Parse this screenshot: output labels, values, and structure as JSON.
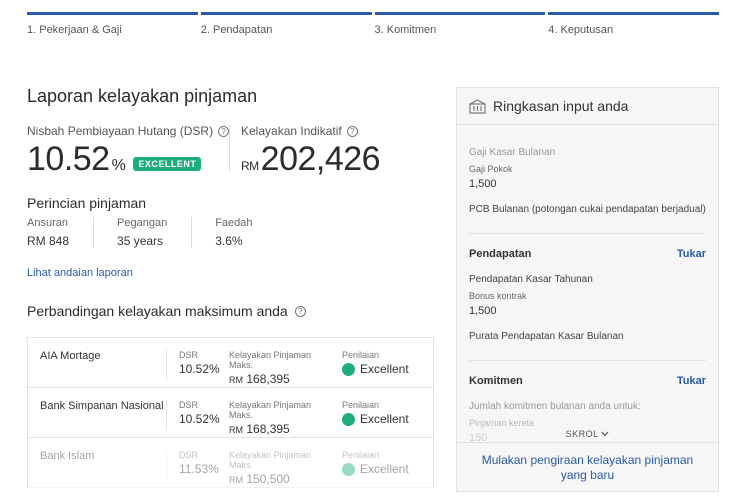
{
  "steps": [
    "1. Pekerjaan & Gaji",
    "2. Pendapatan",
    "3. Komitmen",
    "4. Keputusan"
  ],
  "report": {
    "title": "Laporan kelayakan pinjaman",
    "dsr_label": "Nisbah Pembiayaan Hutang (DSR)",
    "dsr_value": "10.52",
    "dsr_unit": "%",
    "dsr_badge": "EXCELLENT",
    "kel_label": "Kelayakan Indikatif",
    "kel_currency": "RM",
    "kel_value": "202,426"
  },
  "loan": {
    "title": "Perincian pinjaman",
    "cols": [
      {
        "label": "Ansuran",
        "value": "RM 848"
      },
      {
        "label": "Pegangan",
        "value": "35 years"
      },
      {
        "label": "Faedah",
        "value": "3.6%"
      }
    ],
    "link": "Lihat andaian laporan"
  },
  "comparison": {
    "title": "Perbandingan kelayakan maksimum anda",
    "col_dsr": "DSR",
    "col_kel": "Kelayakan Pinjaman Maks.",
    "col_rating": "Penilaian",
    "rows": [
      {
        "bank": "AIA Mortage",
        "dsr": "10.52%",
        "rm": "RM",
        "amount": "168,395",
        "rating": "Excellent"
      },
      {
        "bank": "Bank Simpanan Nasional",
        "dsr": "10.52%",
        "rm": "RM",
        "amount": "168,395",
        "rating": "Excellent"
      },
      {
        "bank": "Bank Islam",
        "dsr": "11.53%",
        "rm": "RM",
        "amount": "150,500",
        "rating": "Excellent"
      }
    ]
  },
  "panel": {
    "title": "Ringkasan input anda",
    "gaji_kasar": "Gaji Kasar Bulanan",
    "gaji_pokok": "Gaji Pokok",
    "gaji_pokok_val": "1,500",
    "pcb": "PCB Bulanan (potongan cukai pendapatan berjadual)",
    "pendapatan_head": "Pendapatan",
    "edit": "Tukar",
    "pendapatan_tahunan": "Pendapatan Kasar Tahunan",
    "bonus": "Bonus kontrak",
    "bonus_val": "1,500",
    "purata": "Purata Pendapatan Kasar Bulanan",
    "komitmen_head": "Komitmen",
    "komitmen_line": "Jumlah komitmen bulanan anda untuk:",
    "pinjaman_kereta": "Pinjaman kereta",
    "pinjaman_val": "150",
    "skrol": "SKROL",
    "footer": "Mulakan pengiraan kelayakan pinjaman yang baru"
  },
  "colors": {
    "accent": "#2a5ba8",
    "success": "#1fae7b"
  },
  "icons": {
    "help": "help-icon",
    "summary": "building-icon",
    "scroll": "chevron-down-icon"
  }
}
